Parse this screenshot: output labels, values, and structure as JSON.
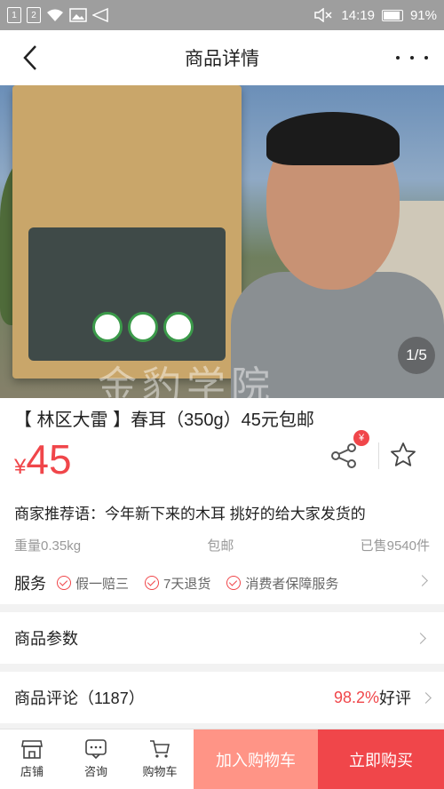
{
  "status_bar": {
    "sim1": "1",
    "sim2": "2",
    "time": "14:19",
    "battery": "91%",
    "battery_level": 0.91
  },
  "nav": {
    "title": "商品详情"
  },
  "gallery": {
    "counter": "1/5",
    "watermark": "金豹学院"
  },
  "product": {
    "title": "【 林区大雷 】春耳（350g）45元包邮",
    "currency": "¥",
    "price": "45",
    "share_badge": "¥",
    "recommend": "商家推荐语：今年新下来的木耳 挑好的给大家发货的",
    "weight": "重量0.35kg",
    "shipping": "包邮",
    "sold": "已售9540件"
  },
  "service": {
    "label": "服务",
    "items": [
      "假一赔三",
      "7天退货",
      "消费者保障服务"
    ]
  },
  "params": {
    "label": "商品参数"
  },
  "reviews": {
    "label": "商品评论（1187）",
    "rate": "98.2%",
    "good": "好评"
  },
  "tabbar": {
    "shop": "店铺",
    "consult": "咨询",
    "cart": "购物车",
    "add_cart": "加入购物车",
    "buy_now": "立即购买"
  },
  "colors": {
    "accent": "#f0464a",
    "add_cart_bg": "#ff9486",
    "status_bg": "#9e9e9e"
  }
}
